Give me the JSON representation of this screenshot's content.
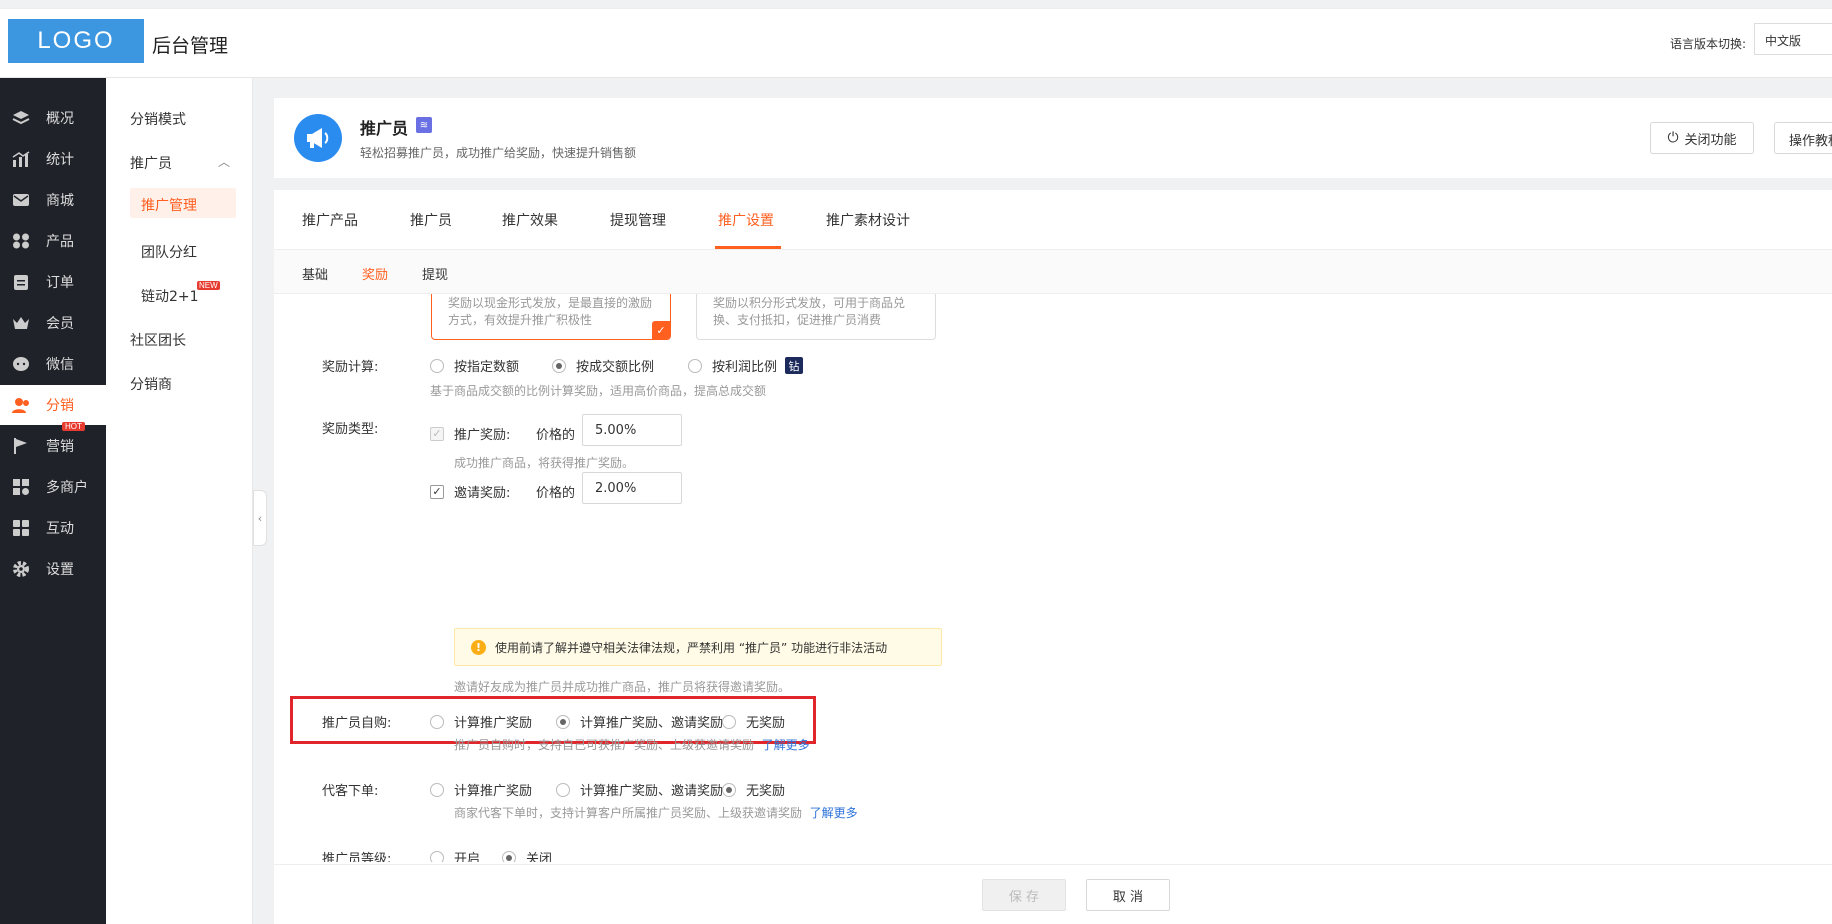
{
  "header": {
    "logo": "LOGO",
    "title": "后台管理",
    "lang_label": "语言版本切换:",
    "lang_value": "中文版"
  },
  "sidebar1": {
    "items": [
      {
        "label": "概况",
        "icon": "layers-icon"
      },
      {
        "label": "统计",
        "icon": "chart-icon"
      },
      {
        "label": "商城",
        "icon": "mail-icon"
      },
      {
        "label": "产品",
        "icon": "grid-icon"
      },
      {
        "label": "订单",
        "icon": "clipboard-icon"
      },
      {
        "label": "会员",
        "icon": "crown-icon"
      },
      {
        "label": "微信",
        "icon": "chat-icon"
      },
      {
        "label": "分销",
        "icon": "user-icon"
      },
      {
        "label": "营销",
        "icon": "flag-icon",
        "badge": "HOT"
      },
      {
        "label": "多商户",
        "icon": "store-icon"
      },
      {
        "label": "互动",
        "icon": "puzzle-icon"
      },
      {
        "label": "设置",
        "icon": "gear-icon"
      }
    ]
  },
  "sidebar2": {
    "items": [
      {
        "label": "分销模式"
      },
      {
        "label": "推广员"
      },
      {
        "label": "推广管理"
      },
      {
        "label": "团队分红"
      },
      {
        "label": "链动2+1",
        "badge": "NEW"
      },
      {
        "label": "社区团长"
      },
      {
        "label": "分销商"
      }
    ]
  },
  "plugin": {
    "title": "推广员",
    "desc": "轻松招募推广员，成功推广给奖励，快速提升销售额",
    "btn_off": "关闭功能",
    "btn_guide": "操作教程"
  },
  "tabs": [
    "推广产品",
    "推广员",
    "推广效果",
    "提现管理",
    "推广设置",
    "推广素材设计"
  ],
  "subtabs": [
    "基础",
    "奖励",
    "提现"
  ],
  "reward_cards": [
    {
      "text": "奖励以现金形式发放，是最直接的激励方式，有效提升推广积极性",
      "selected": true
    },
    {
      "text": "奖励以积分形式发放，可用于商品兑换、支付抵扣，促进推广员消费",
      "selected": false
    }
  ],
  "calc": {
    "label": "奖励计算:",
    "options": [
      "按指定数额",
      "按成交额比例",
      "按利润比例"
    ],
    "selected": 1,
    "diamond": "钻",
    "hint": "基于商品成交额的比例计算奖励，适用高价商品，提高总成交额"
  },
  "reward_type": {
    "label": "奖励类型:",
    "promo_label": "推广奖励:",
    "price_prefix": "价格的",
    "promo_value": "5.00%",
    "promo_hint": "成功推广商品，将获得推广奖励。",
    "invite_label": "邀请奖励:",
    "invite_value": "2.00%",
    "warning": "使用前请了解并遵守相关法律法规，严禁利用 “推广员” 功能进行非法活动",
    "invite_hint": "邀请好友成为推广员并成功推广商品，推广员将获得邀请奖励。"
  },
  "self_buy": {
    "label": "推广员自购:",
    "options": [
      "计算推广奖励",
      "计算推广奖励、邀请奖励",
      "无奖励"
    ],
    "selected": 1,
    "hint": "推广员自购时，支持自己可获推广奖励、上级获邀请奖励",
    "more": "了解更多"
  },
  "proxy_order": {
    "label": "代客下单:",
    "options": [
      "计算推广奖励",
      "计算推广奖励、邀请奖励",
      "无奖励"
    ],
    "selected": 2,
    "hint": "商家代客下单时，支持计算客户所属推广员奖励、上级获邀请奖励",
    "more": "了解更多"
  },
  "level": {
    "label": "推广员等级:",
    "options": [
      "开启",
      "关闭"
    ],
    "selected": 1
  },
  "footer": {
    "save": "保 存",
    "cancel": "取 消"
  },
  "colors": {
    "accent": "#ff5f1f",
    "sidebar_bg": "#1f2228",
    "logo_bg": "#3d96e0",
    "highlight_box": "#e0262b"
  }
}
